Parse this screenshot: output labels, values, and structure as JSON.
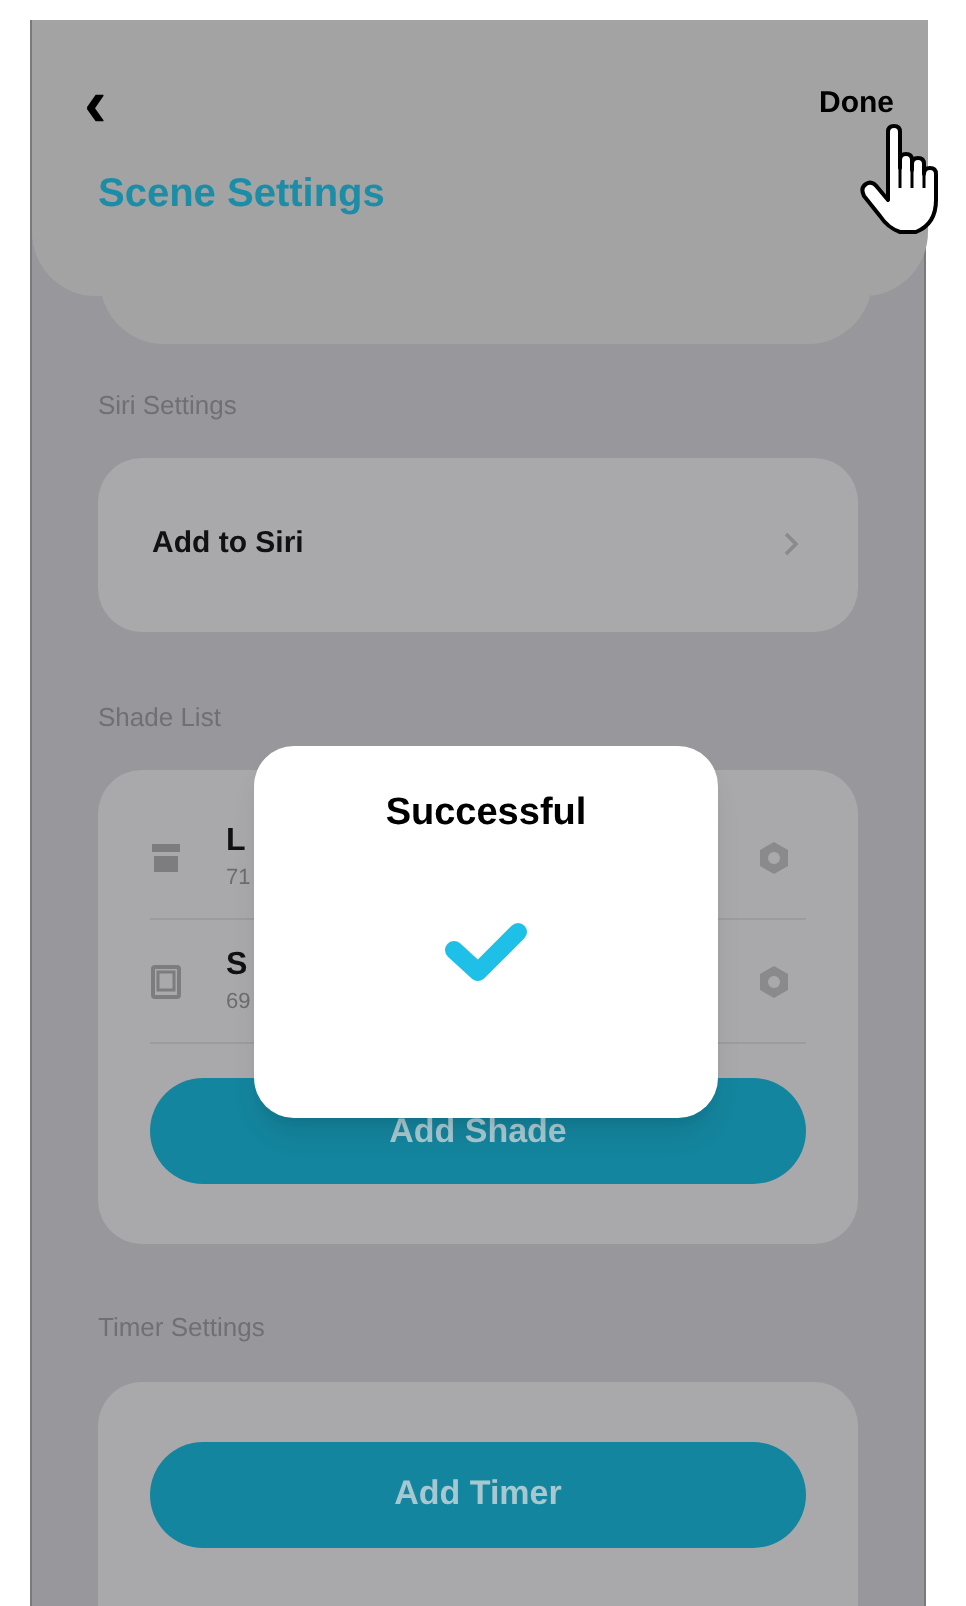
{
  "header": {
    "back_icon": "‹",
    "done": "Done",
    "title": "Scene Settings"
  },
  "siri": {
    "section_label": "Siri Settings",
    "item": "Add to Siri"
  },
  "shade_list": {
    "section_label": "Shade List",
    "shades": [
      {
        "kind": "roller",
        "name": "L",
        "detail": "71"
      },
      {
        "kind": "book",
        "name": "S",
        "detail": "69"
      }
    ],
    "add_button": "Add Shade"
  },
  "timer": {
    "section_label": "Timer Settings",
    "add_button": "Add Timer"
  },
  "dialog": {
    "title": "Successful"
  }
}
